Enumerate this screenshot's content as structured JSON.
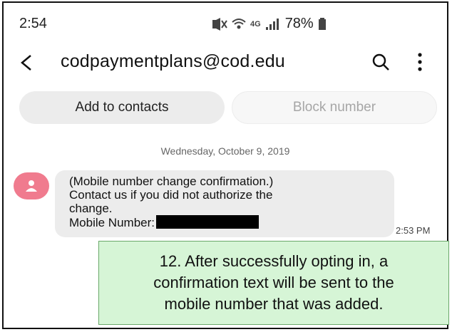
{
  "status_bar": {
    "time": "2:54",
    "network_label": "4G",
    "battery_percent": "78%",
    "icons": [
      "mute-icon",
      "wifi-icon",
      "4g-icon",
      "signal-icon",
      "battery-icon"
    ]
  },
  "header": {
    "title": "codpaymentplans@cod.edu",
    "back_icon": "back-arrow-icon",
    "search_icon": "search-icon",
    "more_icon": "more-vertical-icon"
  },
  "actions": {
    "add_contacts": "Add to contacts",
    "block_number": "Block number"
  },
  "conversation": {
    "date": "Wednesday, October 9, 2019",
    "message": {
      "lines": [
        "(Mobile number change confirmation.)",
        "Contact us if you did not authorize the",
        "change.",
        "Mobile Number:"
      ],
      "time": "2:53 PM"
    }
  },
  "callout": {
    "lines": [
      "12. After successfully opting in, a",
      "confirmation text will be sent to the",
      "mobile number that was added."
    ]
  },
  "colors": {
    "avatar": "#f07b8e",
    "bubble": "#ececec",
    "callout_bg": "#d6f5d6",
    "callout_border": "#6aa86a"
  }
}
